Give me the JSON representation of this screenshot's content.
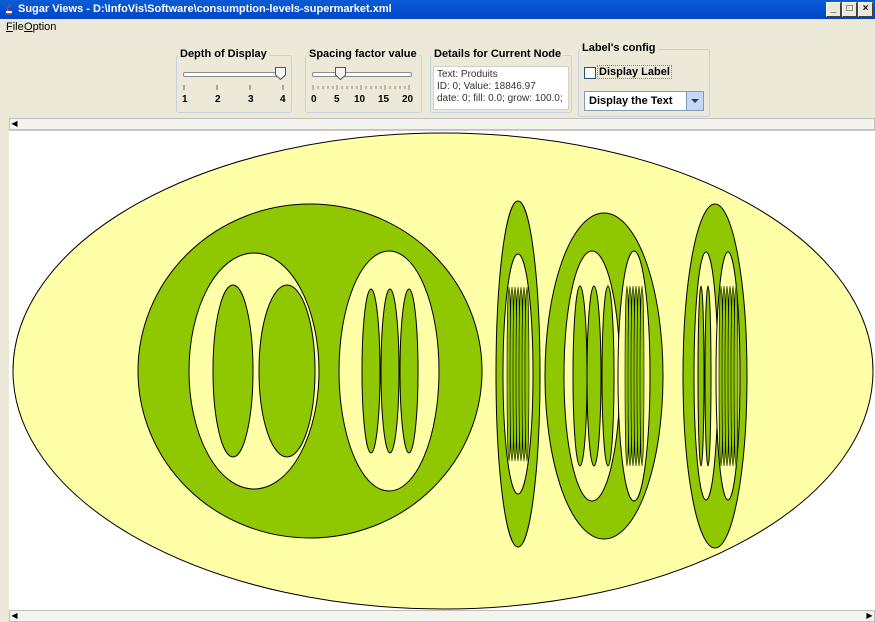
{
  "window": {
    "title": "Sugar Views - D:\\InfoVis\\Software\\consumption-levels-supermarket.xml"
  },
  "menu": [
    {
      "mnemonic": "F",
      "rest": "ile"
    },
    {
      "mnemonic": "O",
      "rest": "ption"
    }
  ],
  "depth": {
    "title": "Depth of Display",
    "labels": [
      "1",
      "2",
      "3",
      "4"
    ],
    "value": 4
  },
  "spacing": {
    "title": "Spacing factor value",
    "labels": [
      "0",
      "5",
      "10",
      "15",
      "20"
    ],
    "value": 5
  },
  "details": {
    "title": "Details for Current Node",
    "lines": [
      "Text: Produits",
      "ID: 0; Value: 18846.97",
      "date: 0; fill: 0.0; grow: 100.0;"
    ]
  },
  "label_config": {
    "title": "Label's config",
    "checkbox_label": "Display Label",
    "checked": false,
    "combo_value": "Display the Text"
  },
  "colors": {
    "outer": "#ffffa8",
    "green": "#8fc700",
    "inner_yellow": "#ffffa8",
    "outline": "#000000"
  }
}
